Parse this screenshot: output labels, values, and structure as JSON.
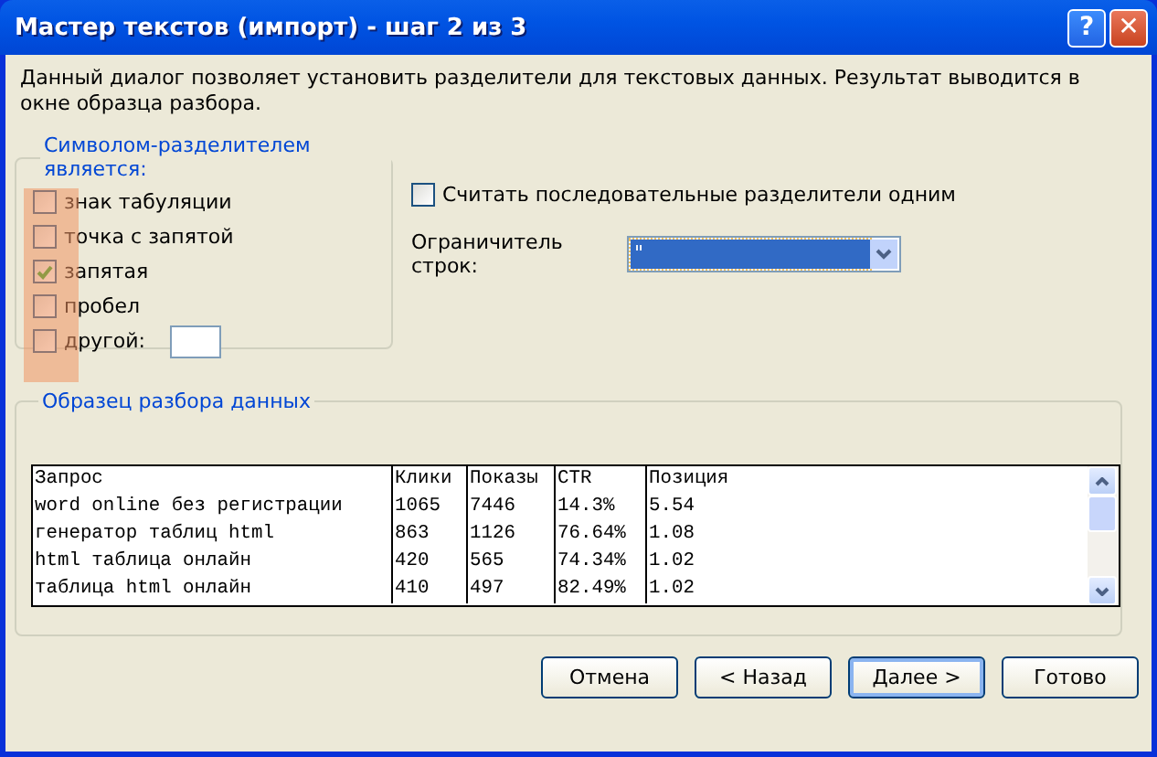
{
  "window": {
    "title": "Мастер текстов (импорт) - шаг 2 из 3",
    "title_buttons": [
      {
        "kind": "help",
        "label": "?"
      },
      {
        "kind": "close",
        "label": "✕"
      }
    ]
  },
  "description": "Данный диалог позволяет установить разделители для текстовых данных. Результат выводится в окне образца разбора.",
  "delimiters": {
    "title": "Символом-разделителем является:",
    "items": [
      {
        "label": "знак табуляции",
        "checked": false
      },
      {
        "label": "точка с запятой",
        "checked": false
      },
      {
        "label": "запятая",
        "checked": true
      },
      {
        "label": "пробел",
        "checked": false
      },
      {
        "label": "другой:",
        "checked": false,
        "kind": "other"
      }
    ]
  },
  "treat_consecutive": {
    "label": "Считать последовательные разделители одним",
    "checked": false
  },
  "text_qualifier": {
    "label": "Ограничитель строк:",
    "value": "\""
  },
  "preview": {
    "title": "Образец разбора данных",
    "columns": [
      "Запрос",
      "Клики",
      "Показы",
      "CTR",
      "Позиция"
    ],
    "rows": [
      [
        "word online без регистрации",
        "1065",
        "7446",
        "14.3%",
        "5.54"
      ],
      [
        "генератор таблиц html",
        "863",
        "1126",
        "76.64%",
        "1.08"
      ],
      [
        "html таблица онлайн",
        "420",
        "565",
        "74.34%",
        "1.02"
      ],
      [
        "таблица html онлайн",
        "410",
        "497",
        "82.49%",
        "1.02"
      ]
    ]
  },
  "buttons": [
    {
      "label": "Отмена",
      "default": false
    },
    {
      "label": "< Назад",
      "default": false
    },
    {
      "label": "Далее >",
      "default": true
    },
    {
      "label": "Готово",
      "default": false
    }
  ]
}
